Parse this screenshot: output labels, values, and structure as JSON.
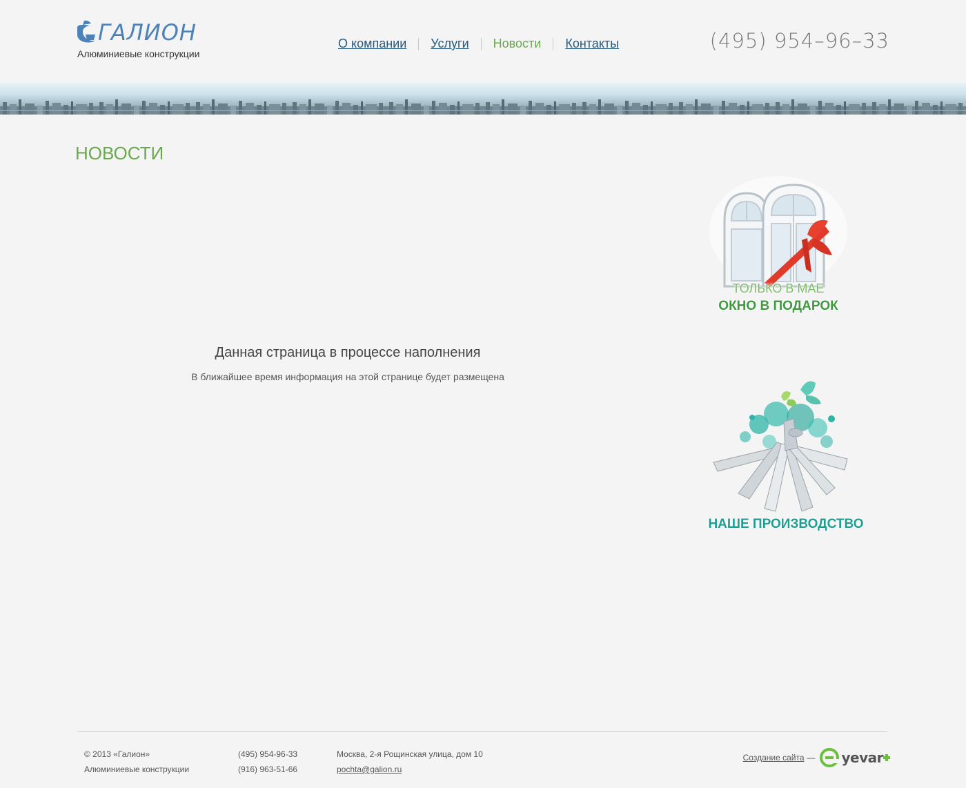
{
  "header": {
    "logo_name": "ГАЛИОН",
    "logo_tagline": "Алюминиевые конструкции",
    "phone": "(495) 954–96–33"
  },
  "nav": {
    "items": [
      {
        "label": "О компании",
        "active": false
      },
      {
        "label": "Услуги",
        "active": false
      },
      {
        "label": "Новости",
        "active": true
      },
      {
        "label": "Контакты",
        "active": false
      }
    ]
  },
  "page": {
    "title": "НОВОСТИ",
    "message_heading": "Данная страница в процессе наполнения",
    "message_text": "В ближайшее время  информация на этой странице будет размещена"
  },
  "promos": {
    "gift": {
      "line1": "ТОЛЬКО В МАЕ",
      "line2": "ОКНО В ПОДАРОК"
    },
    "production": {
      "label": "НАШЕ ПРОИЗВОДСТВО"
    }
  },
  "footer": {
    "copyright": "© 2013  «Галион»",
    "tagline": "Алюминиевые конструкции",
    "phone1": "(495) 954-96-33",
    "phone2": "(916) 963-51-66",
    "address": "Москва, 2-я Рощинская улица, дом 10",
    "email": "pochta@galion.ru",
    "credit_link": "Создание сайта",
    "credit_dash": "—",
    "credit_brand": "yevar"
  },
  "colors": {
    "accent_green": "#6aa84f",
    "link_blue": "#245a83",
    "logo_blue": "#4d82b9",
    "production_teal": "#1e9e93"
  }
}
